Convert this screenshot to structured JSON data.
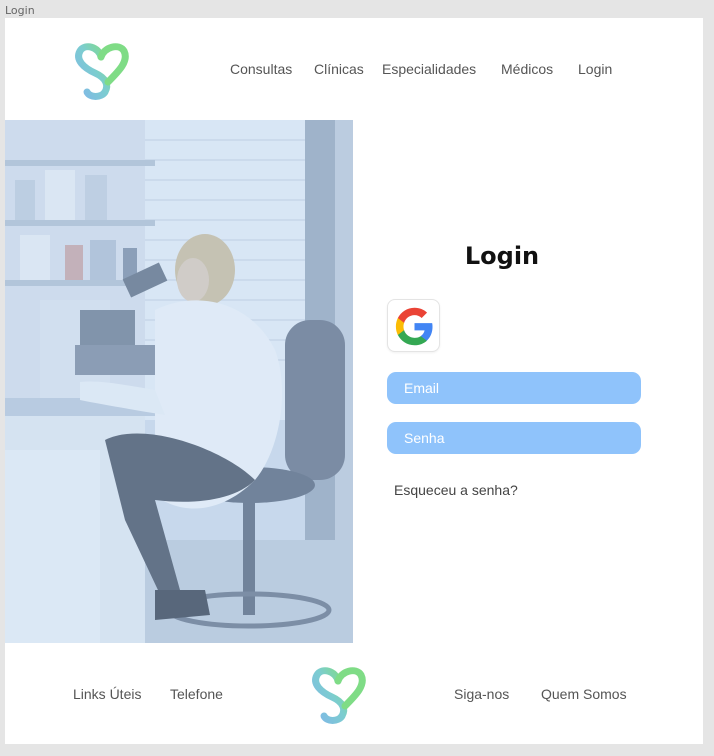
{
  "frame": {
    "label": "Login"
  },
  "header": {
    "nav": [
      {
        "label": "Consultas"
      },
      {
        "label": "Clínicas"
      },
      {
        "label": "Especialidades"
      },
      {
        "label": "Médicos"
      },
      {
        "label": "Login"
      }
    ]
  },
  "login": {
    "title": "Login",
    "google_icon": "google-g-icon",
    "email_placeholder": "Email",
    "password_placeholder": "Senha",
    "forgot_label": "Esqueceu a senha?"
  },
  "footer": {
    "links": [
      {
        "label": "Links Úteis"
      },
      {
        "label": "Telefone"
      },
      {
        "label": "Siga-nos"
      },
      {
        "label": "Quem Somos"
      }
    ]
  },
  "colors": {
    "field_bg": "#8fc3fb",
    "logo_blue": "#7bbde0",
    "logo_green": "#7ed68a"
  }
}
